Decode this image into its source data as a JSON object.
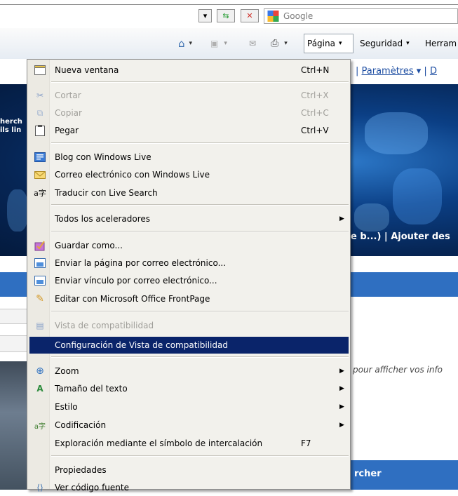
{
  "search": {
    "placeholder": "Google"
  },
  "commandbar": {
    "page_menu": "Página",
    "security_menu": "Seguridad",
    "tools_menu": "Herram"
  },
  "background": {
    "top_links": [
      "Paramètres",
      "D"
    ],
    "left_links": [
      "herch",
      "ils lin"
    ],
    "banner_links": "e b...) | Ajouter des",
    "right_text": "pour afficher vos info",
    "bottom_bar": "rcher"
  },
  "menu": {
    "items": [
      {
        "label": "Nueva ventana",
        "shortcut": "Ctrl+N",
        "icon": "new-window-icon"
      },
      {
        "label": "Cortar",
        "shortcut": "Ctrl+X",
        "icon": "scissors-icon",
        "disabled": true
      },
      {
        "label": "Copiar",
        "shortcut": "Ctrl+C",
        "icon": "copy-icon",
        "disabled": true
      },
      {
        "label": "Pegar",
        "shortcut": "Ctrl+V",
        "icon": "paste-icon"
      },
      {
        "label": "Blog con Windows Live",
        "icon": "blog-icon"
      },
      {
        "label": "Correo electrónico con Windows Live",
        "icon": "mail-icon"
      },
      {
        "label": "Traducir con Live Search",
        "icon": "translate-icon"
      },
      {
        "label": "Todos los aceleradores",
        "submenu": true
      },
      {
        "label": "Guardar como...",
        "icon": "save-icon"
      },
      {
        "label": "Enviar la página por correo electrónico...",
        "icon": "send-page-icon"
      },
      {
        "label": "Enviar vínculo por correo electrónico...",
        "icon": "send-link-icon"
      },
      {
        "label": "Editar con Microsoft Office FrontPage",
        "icon": "edit-pencil-icon"
      },
      {
        "label": "Vista de compatibilidad",
        "icon": "compat-view-icon",
        "disabled": true
      },
      {
        "label": "Configuración de Vista de compatibilidad",
        "highlighted": true
      },
      {
        "label": "Zoom",
        "icon": "zoom-icon",
        "submenu": true
      },
      {
        "label": "Tamaño del texto",
        "icon": "text-size-icon",
        "submenu": true
      },
      {
        "label": "Estilo",
        "submenu": true
      },
      {
        "label": "Codificación",
        "icon": "encoding-icon",
        "submenu": true
      },
      {
        "label": "Exploración mediante el símbolo de intercalación",
        "shortcut": "F7"
      },
      {
        "label": "Propiedades"
      },
      {
        "label": "Ver código fuente",
        "icon": "view-source-icon"
      }
    ]
  }
}
